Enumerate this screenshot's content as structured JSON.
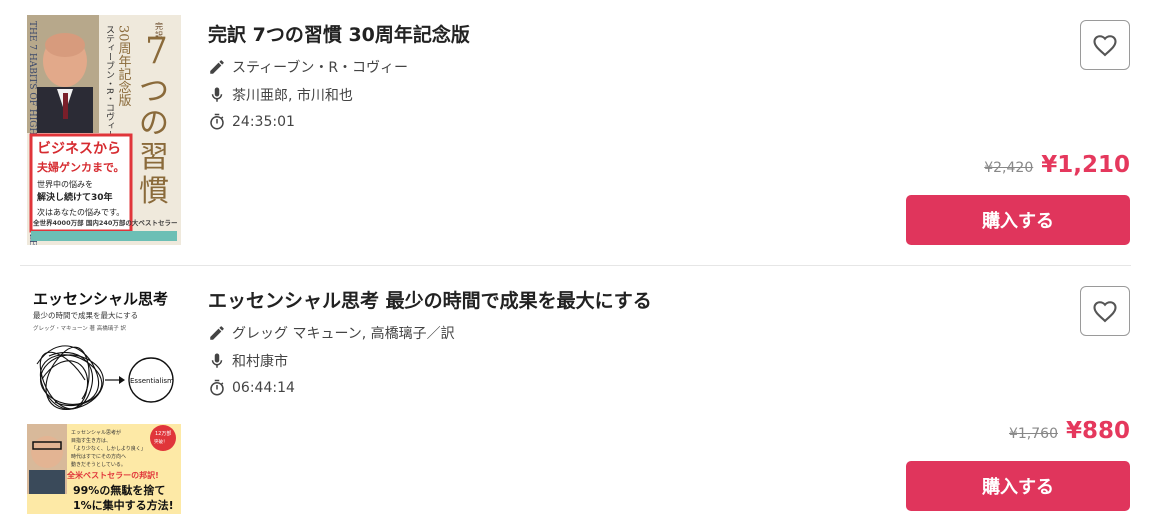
{
  "products": [
    {
      "title": "完訳 7つの習慣 30周年記念版",
      "author": "スティーブン・R・コヴィー",
      "narrator": "茶川亜郎, 市川和也",
      "duration": "24:35:01",
      "original_price": "¥2,420",
      "price": "¥1,210",
      "buy_label": "購入する",
      "cover": {
        "title": "完訳 7つの習慣",
        "subtitle": "30周年記念版",
        "author": "スティーブン・R・コヴィー",
        "tag_line1": "ビジネスから",
        "tag_line2": "夫婦ゲンカまで。",
        "tag_line3": "世界中の悩みを",
        "tag_line4": "解決し続けて30年",
        "tag_line5": "次はあなたの悩みです。",
        "sales": "全世界4000万部 国内240万部の大ベストセラー",
        "spine": "THE 7 HABITS OF HIGHLY EFFECTIVE PEOPLE"
      }
    },
    {
      "title": "エッセンシャル思考 最少の時間で成果を最大にする",
      "author": "グレッグ マキューン, 高橋璃子／訳",
      "narrator": "和村康市",
      "duration": "06:44:14",
      "original_price": "¥1,760",
      "price": "¥880",
      "buy_label": "購入する",
      "cover": {
        "title": "エッセンシャル思考",
        "subtitle": "最少の時間で成果を最大にする",
        "author_line": "グレッグ・マキューン 著 高橋璃子 訳",
        "essentialism": "Essentialism",
        "badge": "12万部突破！ロングセラー",
        "blurb": "エッセンシャル思考が目指す生き方は、「より少なく、しかしより良く」。時代はすでにその方向へ動きだそうとしている。",
        "highlight": "全米ベストセラーの邦訳!",
        "bottom1": "99%の無駄を捨て",
        "bottom2": "1%に集中する方法!"
      }
    }
  ],
  "colors": {
    "accent": "#e0355c",
    "price": "#e5385d"
  },
  "icons": [
    "pencil-icon",
    "microphone-icon",
    "stopwatch-icon",
    "heart-outline-icon"
  ]
}
